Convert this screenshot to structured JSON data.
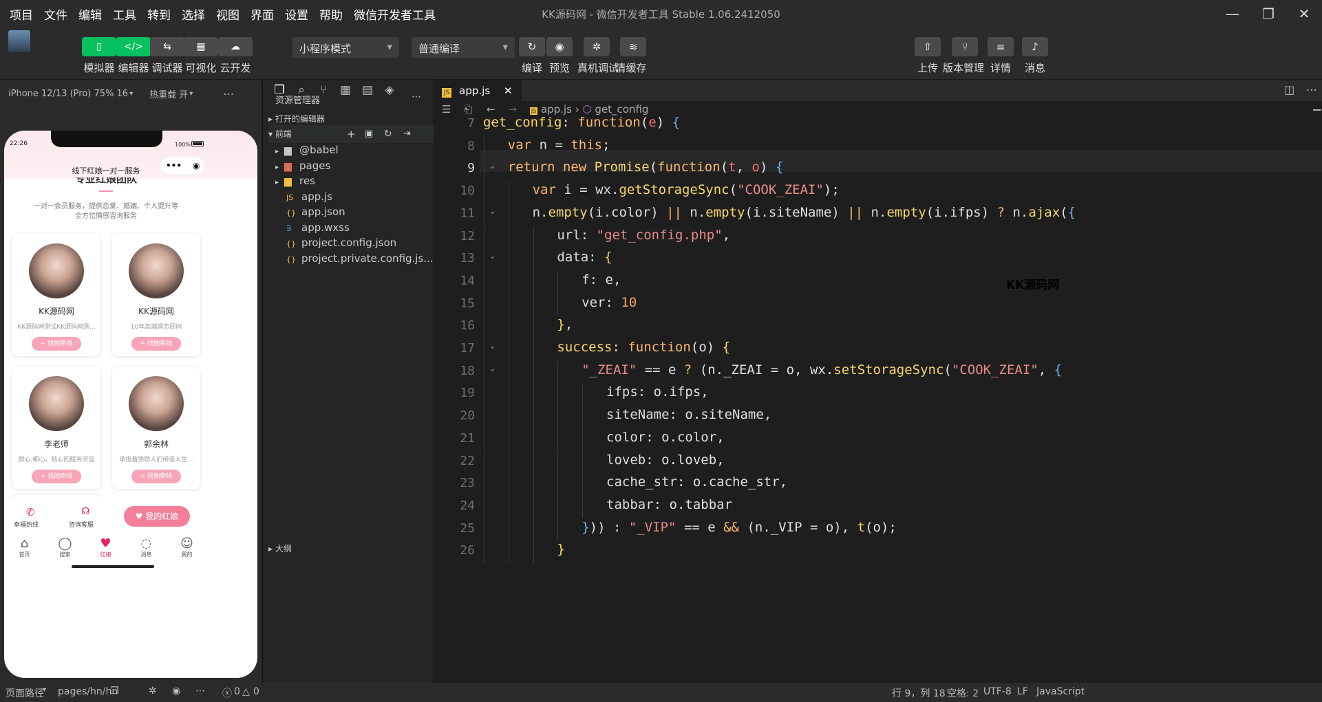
{
  "menubar": {
    "items": [
      "项目",
      "文件",
      "编辑",
      "工具",
      "转到",
      "选择",
      "视图",
      "界面",
      "设置",
      "帮助",
      "微信开发者工具"
    ],
    "window_title": "KK源码网 - 微信开发者工具 Stable 1.06.2412050"
  },
  "toolbar": {
    "left_buttons": [
      {
        "icon": "phone-icon",
        "label": "模拟器",
        "glyph": "▯"
      },
      {
        "icon": "code-icon",
        "label": "编辑器",
        "glyph": "</>"
      },
      {
        "icon": "debug-icon",
        "label": "调试器",
        "glyph": "⇆"
      },
      {
        "icon": "layout-icon",
        "label": "可视化",
        "glyph": "▦"
      },
      {
        "icon": "cloud-icon",
        "label": "云开发",
        "glyph": "☁"
      }
    ],
    "mode_select": "小程序模式",
    "compile_select": "普通编译",
    "mid_buttons": [
      {
        "icon": "refresh-icon",
        "label": "编译",
        "glyph": "↻"
      },
      {
        "icon": "eye-icon",
        "label": "预览",
        "glyph": "◉"
      },
      {
        "icon": "bug-icon",
        "label": "真机调试",
        "glyph": "✲"
      },
      {
        "icon": "layers-icon",
        "label": "清缓存",
        "glyph": "≋"
      }
    ],
    "right_buttons": [
      {
        "icon": "upload-icon",
        "label": "上传",
        "glyph": "⇧"
      },
      {
        "icon": "branch-icon",
        "label": "版本管理",
        "glyph": "⑂"
      },
      {
        "icon": "menu-icon",
        "label": "详情",
        "glyph": "≡"
      },
      {
        "icon": "bell-icon",
        "label": "消息",
        "glyph": "♪"
      }
    ]
  },
  "simulator": {
    "device": "iPhone 12/13 (Pro) 75% 16",
    "hot_reload": "热重载 开",
    "status_time": "22:26",
    "battery": "100%",
    "nav_title": "线下红娘一对一服务",
    "section_title": "专业红娘团队",
    "section_sub1": "一对一会员服务，提供恋爱、婚姻、个人提升等",
    "section_sub2": "全方位情感咨询服务",
    "cards": [
      {
        "name": "KK源码网",
        "desc": "KK源码网测试KK源码网测...",
        "btn": "+ 找她牵线"
      },
      {
        "name": "KK源码网",
        "desc": "10年高端婚恋顾问",
        "btn": "+ 找她牵线"
      },
      {
        "name": "李老师",
        "desc": "耐心,细心，贴心的服务宗旨",
        "btn": "+ 找她牵线"
      },
      {
        "name": "郭余林",
        "desc": "承担着协助人们缔造人生...",
        "btn": "+ 找她牵线"
      }
    ],
    "bottom_actions": {
      "hotline": "幸福热线",
      "service": "咨询客服",
      "my_matchmaker": "我的红娘"
    },
    "tabs": [
      "首页",
      "搜索",
      "红娘",
      "消息",
      "我的"
    ]
  },
  "explorer": {
    "title": "资源管理器",
    "open_editors": "打开的编辑器",
    "project": "前端",
    "items": [
      {
        "name": "@babel",
        "type": "folder"
      },
      {
        "name": "pages",
        "type": "folder"
      },
      {
        "name": "res",
        "type": "folder"
      },
      {
        "name": "app.js",
        "type": "js"
      },
      {
        "name": "app.json",
        "type": "json"
      },
      {
        "name": "app.wxss",
        "type": "wxss"
      },
      {
        "name": "project.config.json",
        "type": "json"
      },
      {
        "name": "project.private.config.js...",
        "type": "json"
      }
    ],
    "outline": "大纲"
  },
  "editor": {
    "tab": "app.js",
    "breadcrumb_file": "app.js",
    "breadcrumb_symbol": "get_config",
    "watermark": "KK源码网",
    "line_numbers": [
      "7",
      "8",
      "9",
      "10",
      "11",
      "12",
      "13",
      "14",
      "15",
      "16",
      "17",
      "18",
      "19",
      "20",
      "21",
      "22",
      "23",
      "24",
      "25",
      "26"
    ]
  },
  "statusbar": {
    "page_path_label": "页面路径",
    "page_path": "pages/hn/hn",
    "errors": "0",
    "warnings": "0",
    "cursor": "行 9，列 18",
    "indent": "空格: 2",
    "encoding": "UTF-8",
    "eol": "LF",
    "language": "JavaScript"
  }
}
